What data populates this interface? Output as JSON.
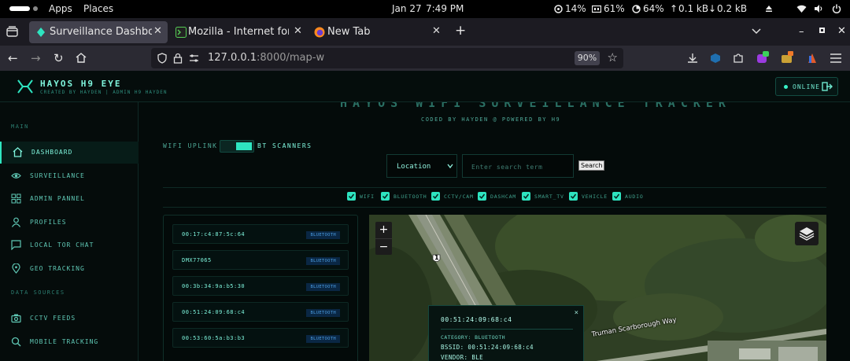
{
  "system_bar": {
    "apps": "Apps",
    "places": "Places",
    "date": "Jan 27",
    "time": "7:49 PM",
    "cpu": "14%",
    "memory": "61%",
    "storage": "64%",
    "net_up": "0.1 kB",
    "net_down": "0.2 kB"
  },
  "tabs": [
    {
      "title": "Surveillance Dashboard",
      "active": true
    },
    {
      "title": "Mozilla - Internet for peo",
      "active": false
    },
    {
      "title": "New Tab",
      "active": false
    }
  ],
  "nav": {
    "url_host": "127.0.0.1",
    "url_rest": ":8000/map-w",
    "zoom": "90%"
  },
  "header": {
    "brand": "HAYOS H9 EYE",
    "brand_sub": "CREATED BY HAYDEN | ADMIN H9 HAYDEN",
    "status": "ONLINE"
  },
  "sidebar": {
    "section_main": "MAIN",
    "section_data": "DATA SOURCES",
    "items": [
      {
        "label": "DASHBOARD",
        "icon": "home-icon",
        "active": true
      },
      {
        "label": "SURVEILLANCE",
        "icon": "eye-icon"
      },
      {
        "label": "ADMIN PANNEL",
        "icon": "grid-icon"
      },
      {
        "label": "PROFILES",
        "icon": "user-icon"
      },
      {
        "label": "LOCAL TOR CHAT",
        "icon": "chat-icon"
      },
      {
        "label": "GEO TRACKING",
        "icon": "pin-icon"
      }
    ],
    "data_items": [
      {
        "label": "CCTV FEEDS",
        "icon": "camera-icon"
      },
      {
        "label": "MOBILE TRACKING",
        "icon": "search-icon"
      }
    ]
  },
  "main": {
    "title": "HAYOS WIFI SURVEILLANCE TRACKER",
    "subtitle": "CODED BY HAYDEN @ POWERED BY H9",
    "uplink_label": "WIFI UPLINK",
    "bt_label": "BT SCANNERS",
    "location_select": "Location",
    "search_placeholder": "Enter search term",
    "search_button": "Search",
    "filters": [
      "WIFI",
      "BLUETOOTH",
      "CCTV/CAM",
      "DASHCAM",
      "SMART_TV",
      "VEHICLE",
      "AUDIO"
    ],
    "devices": [
      {
        "id": "00:17:c4:87:5c:64",
        "tag": "BLUETOOTH"
      },
      {
        "id": "DMX77065",
        "tag": "BLUETOOTH"
      },
      {
        "id": "00:3b:34:9a:b5:30",
        "tag": "BLUETOOTH"
      },
      {
        "id": "00:51:24:09:68:c4",
        "tag": "BLUETOOTH"
      },
      {
        "id": "00:53:60:5a:b3:b3",
        "tag": "BLUETOOTH"
      }
    ]
  },
  "map": {
    "zoom_in": "+",
    "zoom_out": "−",
    "road_label": "Truman Scarborough Way",
    "shield": "1",
    "popup": {
      "title": "00:51:24:09:68:c4",
      "close": "×",
      "category": "CATEGORY: BLUETOOTH",
      "bssid": "BSSID: 00:51:24:09:68:c4",
      "vendor": "VENDOR: BLE"
    }
  },
  "colors": {
    "accent": "#2ee4c0",
    "background": "#040b0a",
    "tag_bg": "#0a2744"
  }
}
